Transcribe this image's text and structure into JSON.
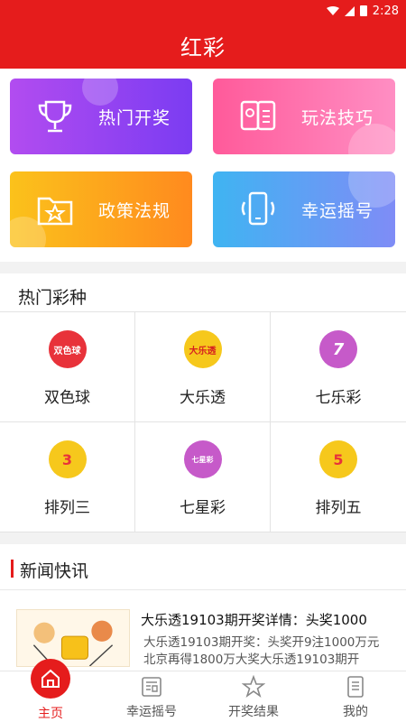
{
  "status_bar": {
    "time": "2:28"
  },
  "header": {
    "title": "红彩"
  },
  "tiles": {
    "hot_draw": "热门开奖",
    "tips": "玩法技巧",
    "policy": "政策法规",
    "lucky_shake": "幸运摇号"
  },
  "hot_section": {
    "title": "热门彩种",
    "items": [
      {
        "label": "双色球",
        "ball_text": "双色球",
        "ball_color": "#e8323a"
      },
      {
        "label": "大乐透",
        "ball_text": "大乐透",
        "ball_color": "#f6c81c"
      },
      {
        "label": "七乐彩",
        "ball_text": "7",
        "ball_color": "#c65ac9"
      },
      {
        "label": "排列三",
        "ball_text": "3",
        "ball_color": "#f6c81c"
      },
      {
        "label": "七星彩",
        "ball_text": "七星彩",
        "ball_color": "#c65ac9"
      },
      {
        "label": "排列五",
        "ball_text": "5",
        "ball_color": "#f6c81c"
      }
    ]
  },
  "news": {
    "title": "新闻快讯",
    "items": [
      {
        "headline": "大乐透19103期开奖详情：头奖1000",
        "summary": "大乐透19103期开奖：头奖开9注1000万元 北京再得1800万大奖大乐透19103期开"
      }
    ]
  },
  "tabbar": {
    "home": "主页",
    "lucky": "幸运摇号",
    "results": "开奖结果",
    "mine": "我的"
  },
  "colors": {
    "brand": "#e51c1c"
  }
}
